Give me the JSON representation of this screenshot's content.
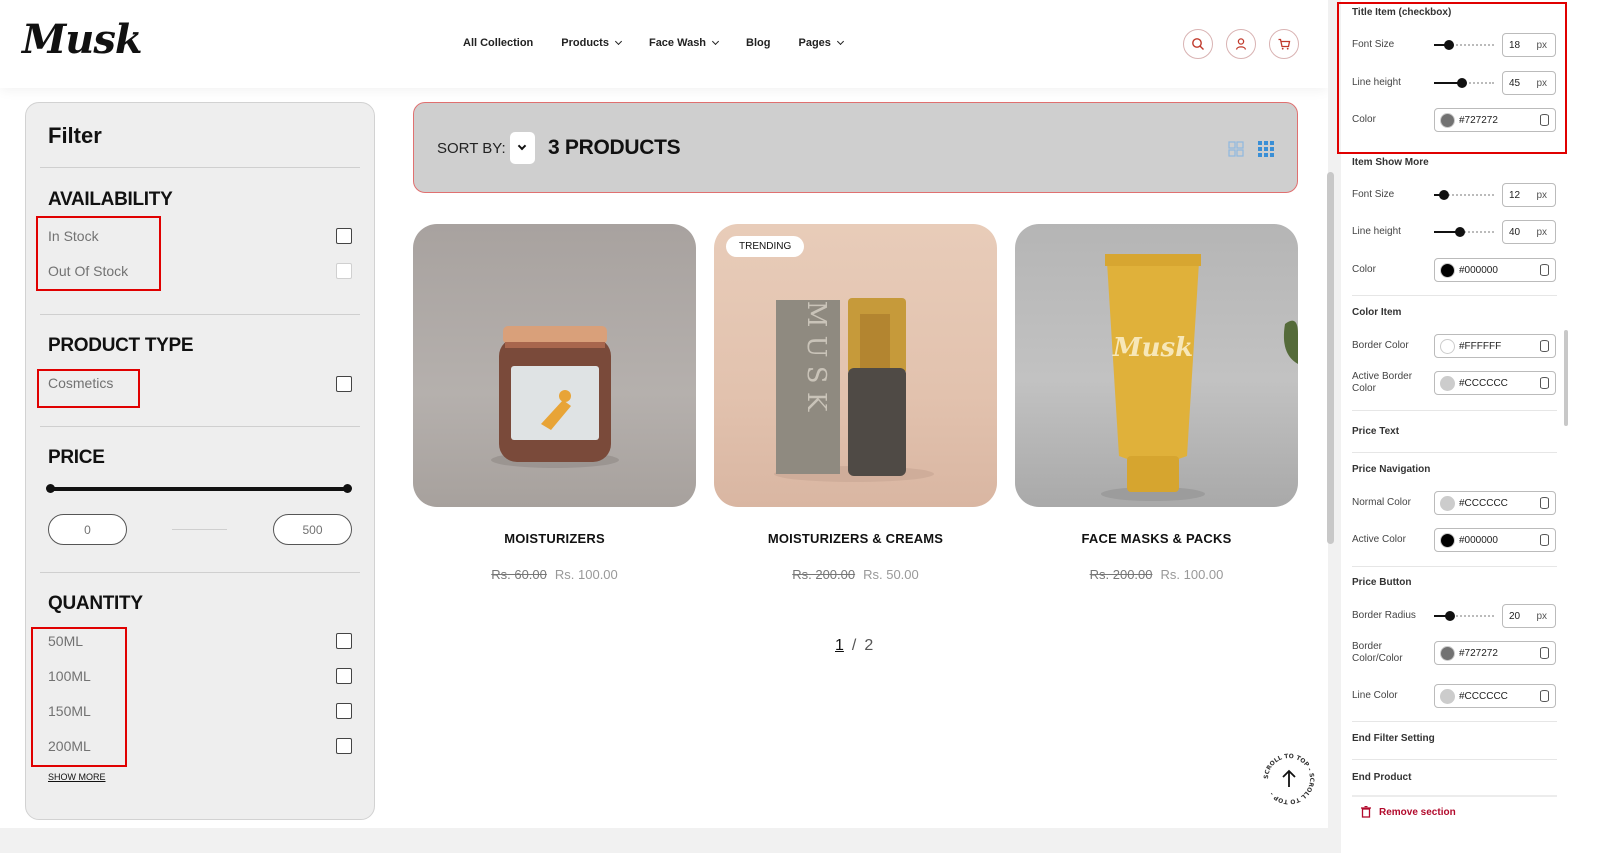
{
  "header": {
    "logo": "Musk",
    "nav": [
      {
        "label": "All Collection",
        "has_dropdown": false
      },
      {
        "label": "Products",
        "has_dropdown": true
      },
      {
        "label": "Face Wash",
        "has_dropdown": true
      },
      {
        "label": "Blog",
        "has_dropdown": false
      },
      {
        "label": "Pages",
        "has_dropdown": true
      }
    ],
    "icons": [
      "search-icon",
      "user-icon",
      "cart-icon"
    ]
  },
  "filter": {
    "title": "Filter",
    "availability": {
      "heading": "AVAILABILITY",
      "items": [
        {
          "label": "In Stock"
        },
        {
          "label": "Out Of Stock"
        }
      ]
    },
    "product_type": {
      "heading": "PRODUCT TYPE",
      "items": [
        {
          "label": "Cosmetics"
        }
      ]
    },
    "price": {
      "heading": "PRICE",
      "min": "0",
      "max": "500"
    },
    "quantity": {
      "heading": "QUANTITY",
      "items": [
        {
          "label": "50ML"
        },
        {
          "label": "100ML"
        },
        {
          "label": "150ML"
        },
        {
          "label": "200ML"
        }
      ],
      "show_more": "SHOW MORE"
    }
  },
  "toolbar": {
    "sort_label": "SORT BY:",
    "product_count": "3 PRODUCTS"
  },
  "products": [
    {
      "name": "MOISTURIZERS",
      "old_price": "Rs. 60.00",
      "price": "Rs. 100.00",
      "badge": "",
      "label": ""
    },
    {
      "name": "MOISTURIZERS & CREAMS",
      "old_price": "Rs. 200.00",
      "price": "Rs. 50.00",
      "badge": "TRENDING",
      "label": "M U S K"
    },
    {
      "name": "FACE MASKS & PACKS",
      "old_price": "Rs. 200.00",
      "price": "Rs. 100.00",
      "badge": "",
      "label": "Musk"
    }
  ],
  "pagination": {
    "current": "1",
    "separator": "/",
    "total": "2"
  },
  "scroll_to_top": "SCROLL TO TOP - SCROLL TO TOP -",
  "settings_panel": {
    "title_item": {
      "heading": "Title Item (checkbox)",
      "font_size_label": "Font Size",
      "font_size": "18",
      "unit": "px",
      "line_height_label": "Line height",
      "line_height": "45",
      "color_label": "Color",
      "color": "#727272"
    },
    "item_show_more": {
      "heading": "Item Show More",
      "font_size_label": "Font Size",
      "font_size": "12",
      "unit": "px",
      "line_height_label": "Line height",
      "line_height": "40",
      "color_label": "Color",
      "color": "#000000"
    },
    "color_item": {
      "heading": "Color Item",
      "border_label": "Border Color",
      "border": "#FFFFFF",
      "active_border_label": "Active Border Color",
      "active_border": "#CCCCCC"
    },
    "price_text": {
      "heading": "Price Text"
    },
    "price_navigation": {
      "heading": "Price Navigation",
      "normal_label": "Normal Color",
      "normal": "#CCCCCC",
      "active_label": "Active Color",
      "active": "#000000"
    },
    "price_button": {
      "heading": "Price Button",
      "radius_label": "Border Radius",
      "radius": "20",
      "unit": "px",
      "border_label": "Border Color/Color",
      "border": "#727272",
      "line_label": "Line Color",
      "line": "#CCCCCC"
    },
    "end_filter": "End Filter Setting",
    "end_product": "End Product",
    "remove": "Remove section"
  }
}
